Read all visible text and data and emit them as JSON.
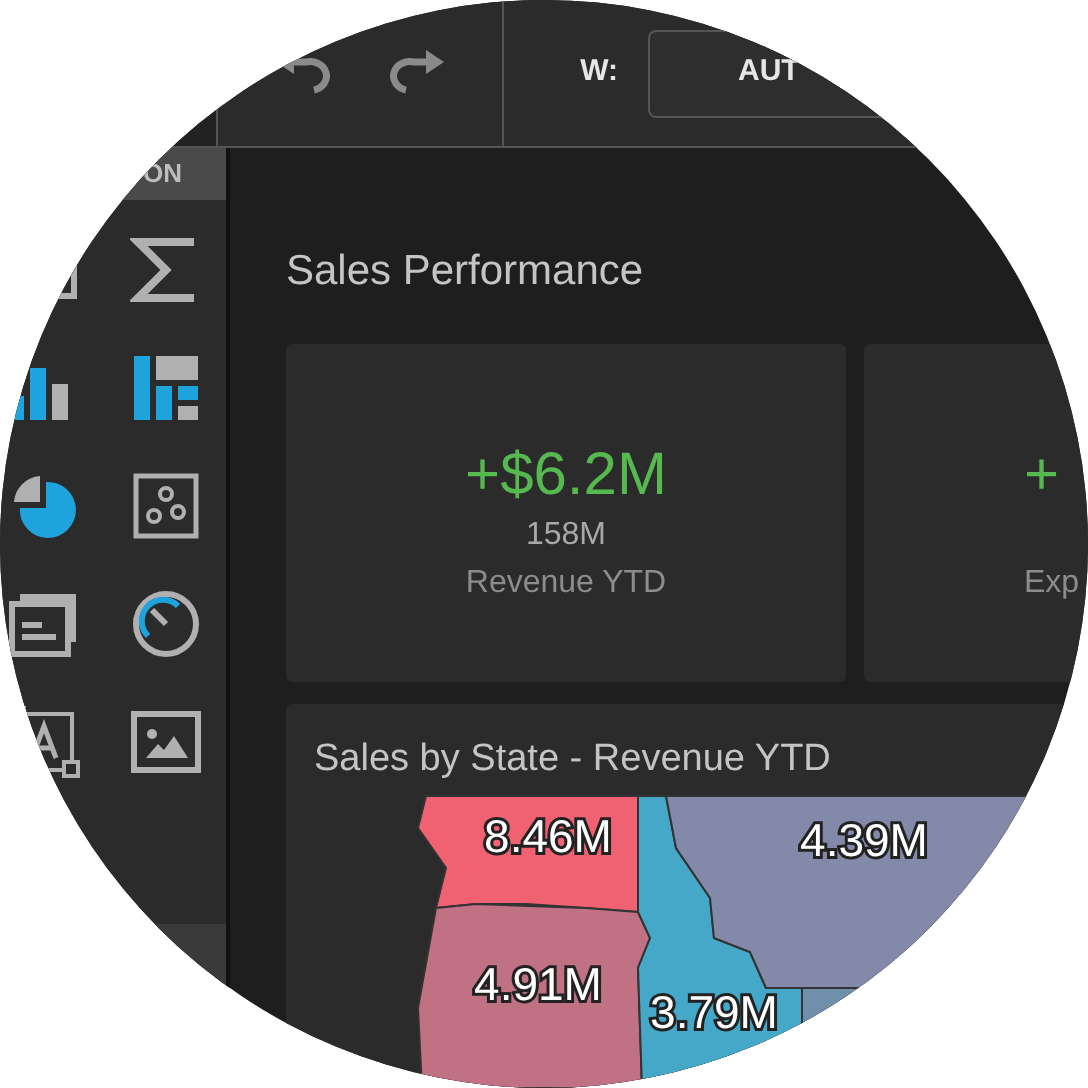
{
  "toolbar": {
    "width_label": "W:",
    "width_value": "AUT"
  },
  "sidebar": {
    "header": "ON"
  },
  "dashboard": {
    "title": "Sales Performance",
    "cards": [
      {
        "delta": "+$6.2M",
        "value": "158M",
        "label": "Revenue YTD"
      },
      {
        "delta": "+",
        "label": "Exp"
      }
    ]
  },
  "map": {
    "title": "Sales by State - Revenue YTD",
    "regions": [
      {
        "label": "8.46M",
        "color": "#f06272"
      },
      {
        "label": "4.91M",
        "color": "#c07284"
      },
      {
        "label": "3.79M",
        "color": "#45a8c8"
      },
      {
        "label": "4.39M",
        "color": "#8289a9"
      },
      {
        "color": "#6f8fab"
      }
    ]
  }
}
